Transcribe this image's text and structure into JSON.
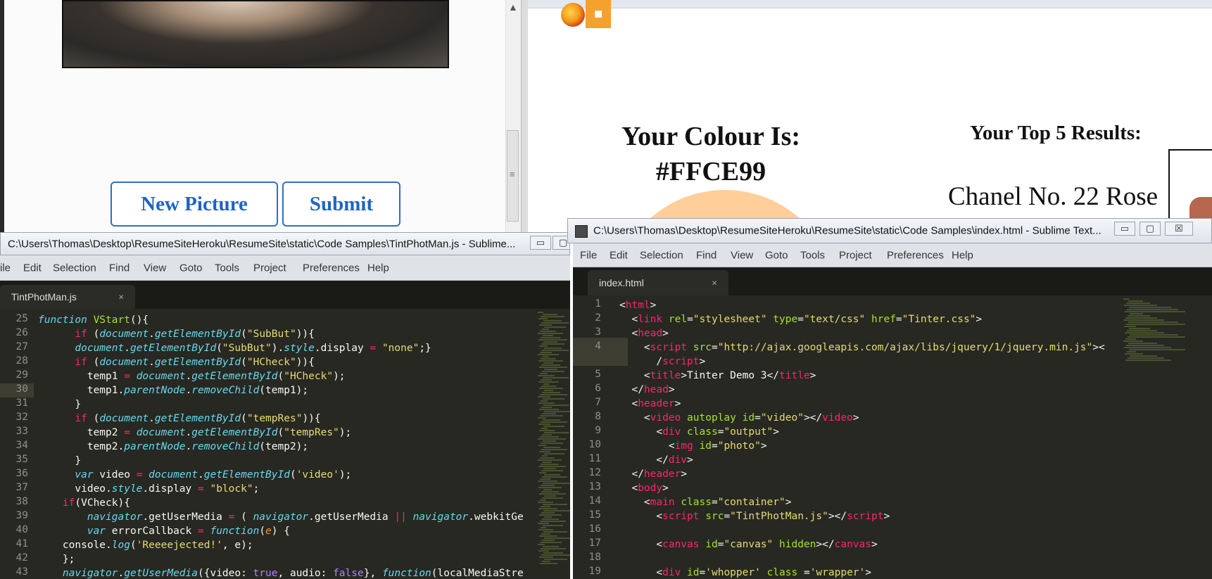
{
  "left_browser": {
    "buttons": {
      "new_picture": "New Picture",
      "submit": "Submit"
    }
  },
  "right_browser": {
    "colour_label": "Your Colour Is:",
    "colour_value": "#FFCE99",
    "top_results_label": "Your Top 5 Results:",
    "result_1": "Chanel No. 22 Rose",
    "swatch_color": "#FFCE99"
  },
  "editor_left": {
    "title": "C:\\Users\\Thomas\\Desktop\\ResumeSiteHeroku\\ResumeSite\\static\\Code Samples\\TintPhotMan.js - Sublime...",
    "menu": [
      "ile",
      "Edit",
      "Selection",
      "Find",
      "View",
      "Goto",
      "Tools",
      "Project",
      "Preferences",
      "Help"
    ],
    "tab": "TintPhotMan.js",
    "line_numbers": [
      "25",
      "26",
      "27",
      "28",
      "29",
      "30",
      "31",
      "32",
      "33",
      "34",
      "35",
      "36",
      "37",
      "38",
      "39",
      "40",
      "41",
      "42",
      "43"
    ]
  },
  "editor_right": {
    "title": "C:\\Users\\Thomas\\Desktop\\ResumeSiteHeroku\\ResumeSite\\static\\Code Samples\\index.html - Sublime Text...",
    "menu": [
      "File",
      "Edit",
      "Selection",
      "Find",
      "View",
      "Goto",
      "Tools",
      "Project",
      "Preferences",
      "Help"
    ],
    "tab": "index.html",
    "line_numbers": [
      "1",
      "2",
      "3",
      "4",
      "",
      "5",
      "6",
      "7",
      "8",
      "9",
      "10",
      "11",
      "12",
      "13",
      "14",
      "15",
      "16",
      "17",
      "18",
      "19"
    ]
  },
  "icons": {
    "close": "×",
    "minimize": "▭",
    "maximize": "▢",
    "window_close": "☒",
    "camera": "■",
    "scroll_up": "▲",
    "grip": "≡"
  }
}
